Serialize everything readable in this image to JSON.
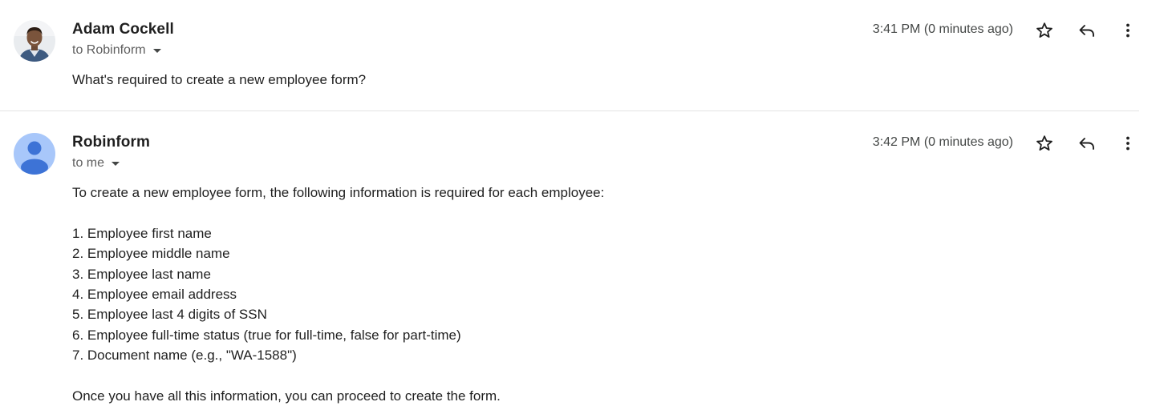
{
  "messages": [
    {
      "sender": "Adam Cockell",
      "recipient": "to Robinform",
      "time": "3:41 PM (0 minutes ago)",
      "avatar": "person-photo",
      "body": {
        "intro": "What's required to create a new employee form?"
      }
    },
    {
      "sender": "Robinform",
      "recipient": "to me",
      "time": "3:42 PM (0 minutes ago)",
      "avatar": "default-person-icon",
      "body": {
        "intro": "To create a new employee form, the following information is required for each employee:",
        "list": [
          "1. Employee first name",
          "2. Employee middle name",
          "3. Employee last name",
          "4. Employee email address",
          "5. Employee last 4 digits of SSN",
          "6. Employee full-time status (true for full-time, false for part-time)",
          "7. Document name (e.g., \"WA-1588\")"
        ],
        "outro": "Once you have all this information, you can proceed to create the form."
      }
    }
  ],
  "icons": {
    "star": "star-outline-icon",
    "reply": "reply-icon",
    "more": "more-vert-icon",
    "dropdown": "caret-down-icon"
  },
  "colors": {
    "text_primary": "#1f1f1f",
    "text_secondary": "#5e5e5e",
    "divider": "#e3e3e3",
    "default_avatar_bg": "#a8c7fa",
    "default_avatar_fg": "#0b57d0"
  }
}
